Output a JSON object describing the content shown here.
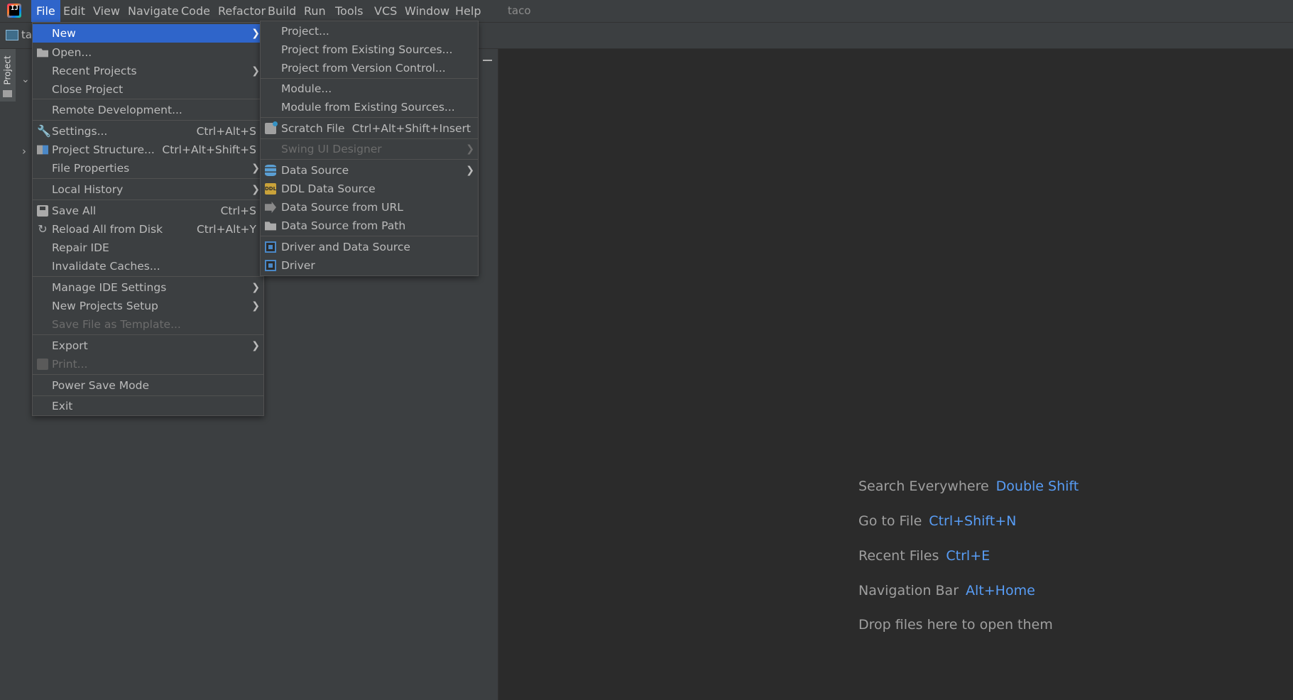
{
  "menubar": {
    "items": [
      "File",
      "Edit",
      "View",
      "Navigate",
      "Code",
      "Refactor",
      "Build",
      "Run",
      "Tools",
      "VCS",
      "Window",
      "Help"
    ],
    "project_name": "taco"
  },
  "toolbar": {
    "crumb": "ta"
  },
  "left_stripe": {
    "project_tab": "Project"
  },
  "file_menu": {
    "new": "New",
    "open": "Open...",
    "recent_projects": "Recent Projects",
    "close_project": "Close Project",
    "remote_development": "Remote Development...",
    "settings": "Settings...",
    "settings_shortcut": "Ctrl+Alt+S",
    "project_structure": "Project Structure...",
    "project_structure_shortcut": "Ctrl+Alt+Shift+S",
    "file_properties": "File Properties",
    "local_history": "Local History",
    "save_all": "Save All",
    "save_all_shortcut": "Ctrl+S",
    "reload_all": "Reload All from Disk",
    "reload_all_shortcut": "Ctrl+Alt+Y",
    "repair_ide": "Repair IDE",
    "invalidate_caches": "Invalidate Caches...",
    "manage_ide_settings": "Manage IDE Settings",
    "new_projects_setup": "New Projects Setup",
    "save_as_template": "Save File as Template...",
    "export": "Export",
    "print": "Print...",
    "power_save_mode": "Power Save Mode",
    "exit": "Exit"
  },
  "new_menu": {
    "project": "Project...",
    "project_existing": "Project from Existing Sources...",
    "project_vcs": "Project from Version Control...",
    "module": "Module...",
    "module_existing": "Module from Existing Sources...",
    "scratch_file": "Scratch File",
    "scratch_file_shortcut": "Ctrl+Alt+Shift+Insert",
    "swing_ui_designer": "Swing UI Designer",
    "data_source": "Data Source",
    "ddl_data_source": "DDL Data Source",
    "data_source_url": "Data Source from URL",
    "data_source_path": "Data Source from Path",
    "driver_and_data_source": "Driver and Data Source",
    "driver": "Driver"
  },
  "editor_hints": [
    {
      "text": "Search Everywhere",
      "key": "Double Shift"
    },
    {
      "text": "Go to File",
      "key": "Ctrl+Shift+N"
    },
    {
      "text": "Recent Files",
      "key": "Ctrl+E"
    },
    {
      "text": "Navigation Bar",
      "key": "Alt+Home"
    },
    {
      "text": "Drop files here to open them",
      "key": ""
    }
  ],
  "colors": {
    "accent": "#2f65ca",
    "shortcut_blue": "#589df6",
    "menu_bg": "#3c3f41",
    "editor_bg": "#2b2b2b"
  }
}
